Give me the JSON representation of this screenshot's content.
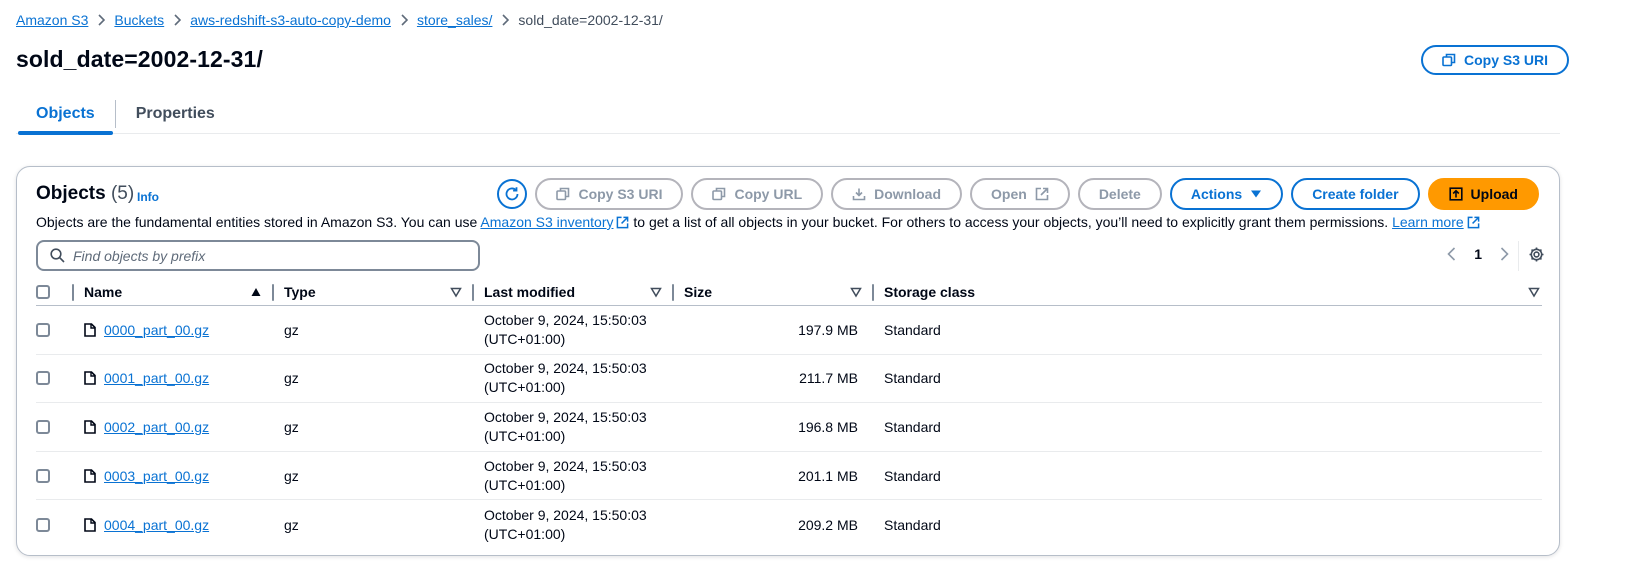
{
  "breadcrumb": {
    "items": [
      "Amazon S3",
      "Buckets",
      "aws-redshift-s3-auto-copy-demo",
      "store_sales/"
    ],
    "current": "sold_date=2002-12-31/"
  },
  "header": {
    "title": "sold_date=2002-12-31/",
    "copy_uri_label": "Copy S3 URI"
  },
  "tabs": [
    {
      "label": "Objects",
      "active": true
    },
    {
      "label": "Properties",
      "active": false
    }
  ],
  "objects_panel": {
    "title": "Objects",
    "count": "(5)",
    "info_label": "Info",
    "toolbar": {
      "copy_s3_uri": "Copy S3 URI",
      "copy_url": "Copy URL",
      "download": "Download",
      "open": "Open",
      "delete": "Delete",
      "actions": "Actions",
      "create_folder": "Create folder",
      "upload": "Upload"
    },
    "description": {
      "before": "Objects are the fundamental entities stored in Amazon S3. You can use ",
      "inventory_link": "Amazon S3 inventory",
      "middle": " to get a list of all objects in your bucket. For others to access your objects, you’ll need to explicitly grant them permissions. ",
      "learn_more": "Learn more"
    },
    "search": {
      "placeholder": "Find objects by prefix",
      "value": ""
    },
    "pagination": {
      "current_page": "1"
    },
    "columns": [
      "Name",
      "Type",
      "Last modified",
      "Size",
      "Storage class"
    ],
    "rows": [
      {
        "name": "0000_part_00.gz",
        "type": "gz",
        "modified": "October 9, 2024, 15:50:03 (UTC+01:00)",
        "size": "197.9 MB",
        "storage_class": "Standard"
      },
      {
        "name": "0001_part_00.gz",
        "type": "gz",
        "modified": "October 9, 2024, 15:50:03 (UTC+01:00)",
        "size": "211.7 MB",
        "storage_class": "Standard"
      },
      {
        "name": "0002_part_00.gz",
        "type": "gz",
        "modified": "October 9, 2024, 15:50:03 (UTC+01:00)",
        "size": "196.8 MB",
        "storage_class": "Standard"
      },
      {
        "name": "0003_part_00.gz",
        "type": "gz",
        "modified": "October 9, 2024, 15:50:03 (UTC+01:00)",
        "size": "201.1 MB",
        "storage_class": "Standard"
      },
      {
        "name": "0004_part_00.gz",
        "type": "gz",
        "modified": "October 9, 2024, 15:50:03 (UTC+01:00)",
        "size": "209.2 MB",
        "storage_class": "Standard"
      }
    ]
  },
  "colors": {
    "link": "#0972d3",
    "primary_button": "#ff9900",
    "disabled": "#8d99a8",
    "text": "#000716"
  }
}
